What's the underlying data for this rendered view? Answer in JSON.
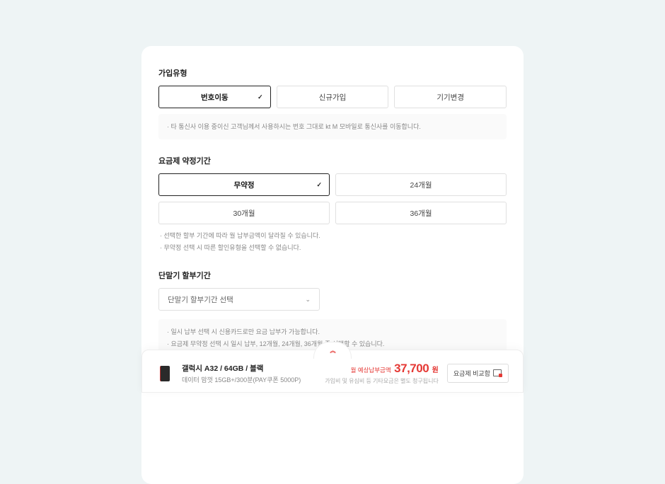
{
  "subscription": {
    "title": "가입유형",
    "options": [
      "번호이동",
      "신규가입",
      "기기변경"
    ],
    "selected_index": 0,
    "note": "타 통신사 이용 중이신 고객님께서 사용하시는 번호 그대로 kt M 모바일로 통신사를 이동합니다."
  },
  "contract": {
    "title": "요금제 약정기간",
    "options": [
      "무약정",
      "24개월",
      "30개월",
      "36개월"
    ],
    "selected_index": 0,
    "notes": [
      "선택한 할부 기간에 따라 월 납부금액이 달라질 수 있습니다.",
      "무약정 선택 시 따른 할인유형을 선택할 수 없습니다."
    ]
  },
  "installment": {
    "title": "단말기 할부기간",
    "placeholder": "단말기 할부기간 선택",
    "notes": [
      "일시 납부 선택 시 신용카드로만 요금 납부가 가능합니다.",
      "요금제 무약정 선택 시 일시 납부, 12개월, 24개월, 36개월 중 선택할 수 있습니다."
    ]
  },
  "bottom": {
    "product_name": "갤럭시 A32 / 64GB / 블랙",
    "plan_name": "데이터 맘껏 15GB+/300분(PAY쿠폰 5000P)",
    "price_label": "월 예상납부금액",
    "price_amount": "37,700",
    "price_unit": "원",
    "price_note": "가입비 및 유심비 등 기타요금은 별도 청구됩니다",
    "compare_label": "요금제 비교함"
  }
}
